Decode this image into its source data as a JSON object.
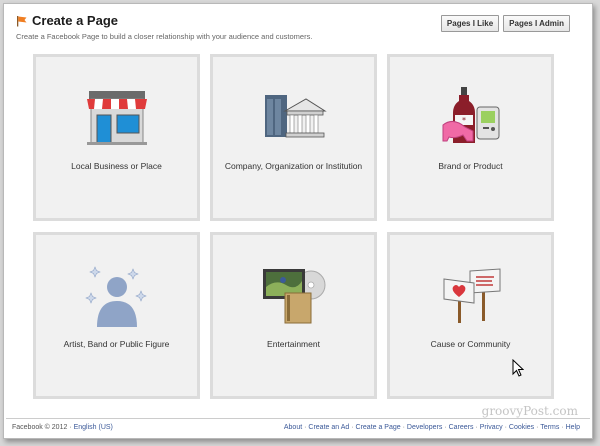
{
  "header": {
    "title": "Create a Page",
    "subtitle": "Create a Facebook Page to build a closer relationship with your audience and customers."
  },
  "top_buttons": {
    "pages_i_like": "Pages I Like",
    "pages_i_admin": "Pages I Admin"
  },
  "categories": [
    {
      "label": "Local Business or Place",
      "icon": "storefront-icon"
    },
    {
      "label": "Company, Organization or Institution",
      "icon": "company-buildings-icon"
    },
    {
      "label": "Brand or Product",
      "icon": "brand-products-icon"
    },
    {
      "label": "Artist, Band or Public Figure",
      "icon": "person-silhouette-icon"
    },
    {
      "label": "Entertainment",
      "icon": "entertainment-icon"
    },
    {
      "label": "Cause or Community",
      "icon": "protest-signs-icon"
    }
  ],
  "footer": {
    "copyright": "Facebook © 2012 · ",
    "language": "English (US)",
    "links": [
      "About",
      "Create an Ad",
      "Create a Page",
      "Developers",
      "Careers",
      "Privacy",
      "Cookies",
      "Terms",
      "Help"
    ],
    "separator": " · "
  },
  "watermark": "groovyPost.com"
}
